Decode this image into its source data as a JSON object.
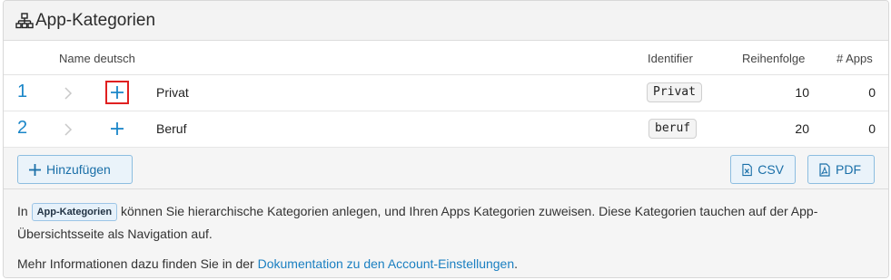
{
  "header": {
    "title": "App-Kategorien",
    "icon": "sitemap-icon"
  },
  "columns": {
    "name": "Name deutsch",
    "identifier": "Identifier",
    "order": "Reihenfolge",
    "apps": "# Apps"
  },
  "rows": [
    {
      "number": "1",
      "name": "Privat",
      "identifier": "Privat",
      "order": "10",
      "apps": "0"
    },
    {
      "number": "2",
      "name": "Beruf",
      "identifier": "beruf",
      "order": "20",
      "apps": "0"
    }
  ],
  "toolbar": {
    "add_label": "Hinzufügen",
    "csv_label": "CSV",
    "pdf_label": "PDF"
  },
  "info": {
    "prefix": "In ",
    "chip": "App-Kategorien",
    "text1_line1": " können Sie hierarchische Kategorien anlegen, und Ihren Apps Kategorien zuweisen. Diese Kategorien tauchen auf der App-",
    "text1_line2": "Übersichtsseite als Navigation auf.",
    "text2_prefix": "Mehr Informationen dazu finden Sie in der ",
    "link": "Dokumentation zu den Account-Einstellungen",
    "text2_suffix": "."
  },
  "colors": {
    "accent": "#1a86c8",
    "focus": "#e02020"
  }
}
